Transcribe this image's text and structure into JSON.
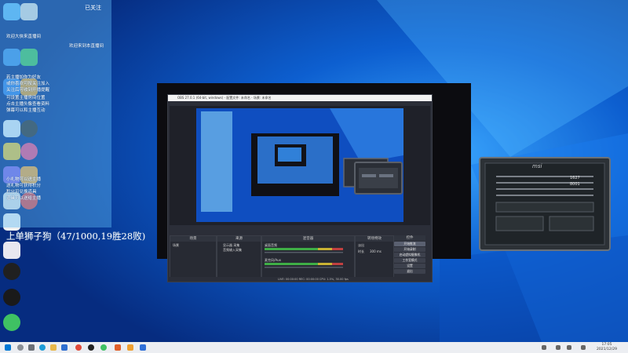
{
  "chat": {
    "top_label": "已关注",
    "lines": [
      "欢迎大侠来直播间",
      "欢迎来到本直播间",
      "若主播加你为好友",
      "或你喜欢可按关注加入",
      "关注后可收到开播提醒",
      "可设置主播房间位置",
      "点击主播头像查看资料",
      "弹幕可以和主播互动",
      "小礼物可以送主播",
      "送礼物可获得积分",
      "积分可兑换道具",
      "道具可以送给主播"
    ],
    "stream_title": "上单狮子狗（47/1000,19胜28败)"
  },
  "obs": {
    "title": "OBS 27.0.1 (64-bit, windows) - 配置文件: 未命名 - 场景: 未命名",
    "panels": {
      "scenes": "场景",
      "sources": "来源",
      "mixer": "混音器",
      "transitions": "转场特效",
      "controls": "控件"
    },
    "scene_item": "场景",
    "source_items": [
      "显示器 采集",
      "音频输入采集"
    ],
    "mixer_tracks": [
      "桌面音频",
      "麦克风/Aux"
    ],
    "transition_value": "淡出",
    "duration_label": "时长",
    "duration_value": "300 ms",
    "control_buttons": [
      "开始推流",
      "开始录制",
      "启动虚拟摄像机",
      "工作室模式",
      "设置",
      "退出"
    ],
    "status": "LIVE: 00:00:00   REC: 00:00:00   CPU: 1.5%, 30.00 fps"
  },
  "msi": {
    "brand": "msi",
    "values": [
      "1627",
      "8001"
    ]
  },
  "taskbar": {
    "time": "17:05",
    "date": "2021/12/29"
  },
  "colors": {
    "chat_overlay": "#5fb9f5",
    "obs_bg": "#2b2e38",
    "wallpaper": "#0a3e9c"
  }
}
